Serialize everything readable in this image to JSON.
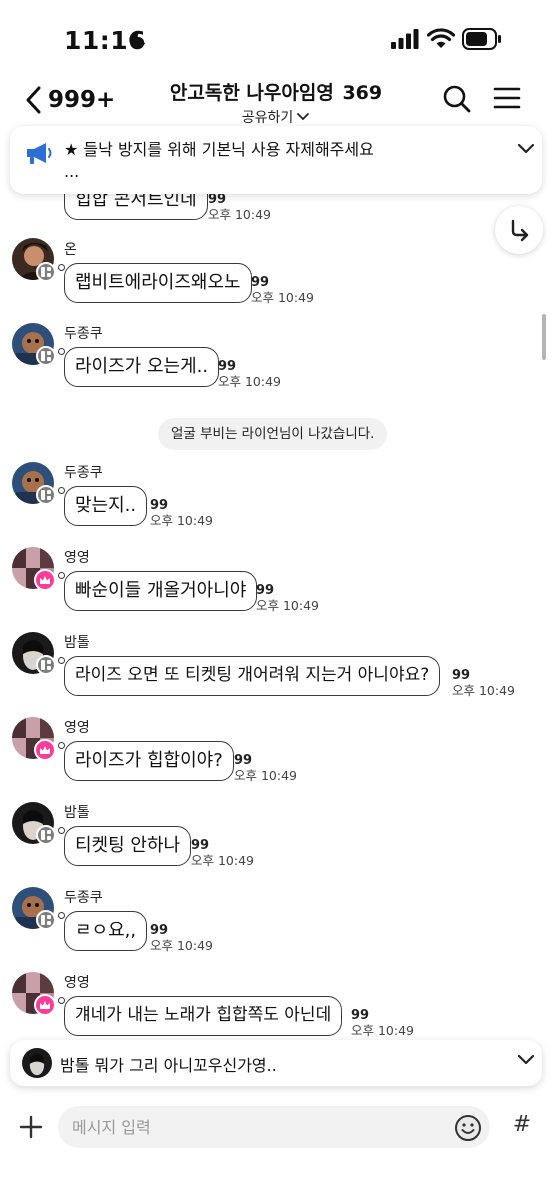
{
  "status_bar": {
    "time": "11:16",
    "icons": [
      "moon-icon",
      "signal-icon",
      "wifi-icon",
      "battery-icon"
    ]
  },
  "header": {
    "back_count": "999+",
    "title": "안고독한 나우아임영",
    "member_count": "369",
    "share_label": "공유하기",
    "icons": [
      "back-icon",
      "search-icon",
      "menu-icon",
      "chevron-down-icon"
    ]
  },
  "notice": {
    "icon": "megaphone-icon",
    "text": "★ 들낙 방지를 위해 기본닉 사용 자제해주세요",
    "ellipsis": "..."
  },
  "system_message": "얼굴 부비는 라이언님이 나갔습니다.",
  "messages": [
    {
      "sender": "",
      "text": "힙합 콘서트인데",
      "count": "99",
      "time": "오후 10:49",
      "badge": "none"
    },
    {
      "sender": "온",
      "text": "랩비트에라이즈왜오노",
      "count": "99",
      "time": "오후 10:49",
      "badge": "category"
    },
    {
      "sender": "두종쿠",
      "text": "라이즈가 오는게..",
      "count": "99",
      "time": "오후 10:49",
      "badge": "category"
    },
    {
      "sender": "두종쿠",
      "text": "맞는지..",
      "count": "99",
      "time": "오후 10:49",
      "badge": "category"
    },
    {
      "sender": "영영",
      "text": "빠순이들 개올거아니야",
      "count": "99",
      "time": "오후 10:49",
      "badge": "crown"
    },
    {
      "sender": "밤톨",
      "text": "라이즈 오면 또 티켓팅 개어려워 지는거 아니야요?",
      "count": "99",
      "time": "오후 10:49",
      "badge": "category"
    },
    {
      "sender": "영영",
      "text": "라이즈가 힙합이야?",
      "count": "99",
      "time": "오후 10:49",
      "badge": "crown"
    },
    {
      "sender": "밤톨",
      "text": "티켓팅 안하나",
      "count": "99",
      "time": "오후 10:49",
      "badge": "category"
    },
    {
      "sender": "두종쿠",
      "text": "ㄹㅇ요,,",
      "count": "99",
      "time": "오후 10:49",
      "badge": "category"
    },
    {
      "sender": "영영",
      "text": "걔네가 내는 노래가 힙합쪽도 아닌데",
      "count": "99",
      "time": "오후 10:49",
      "badge": "crown"
    }
  ],
  "pinned": {
    "sender": "밤톨",
    "text": "뭐가 그리 아니꼬우신가영.."
  },
  "input": {
    "placeholder": "메시지 입력",
    "icons": [
      "plus-icon",
      "emoji-icon",
      "hash-icon"
    ]
  },
  "colors": {
    "bubble_border": "#3a3a3a",
    "crown_badge": "#ff3b9a",
    "category_badge": "#7d7d7d",
    "notice_icon": "#2b6fd6"
  }
}
